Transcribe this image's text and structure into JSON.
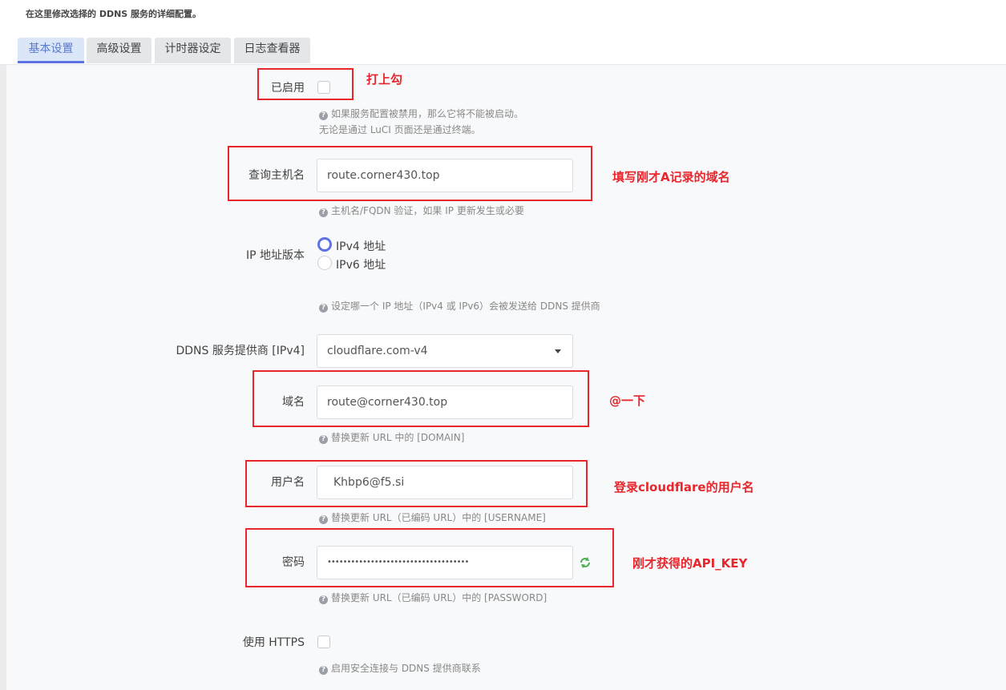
{
  "page": {
    "description": "在这里修改选择的 DDNS 服务的详细配置。"
  },
  "tabs": [
    {
      "label": "基本设置",
      "active": true
    },
    {
      "label": "高级设置",
      "active": false
    },
    {
      "label": "计时器设定",
      "active": false
    },
    {
      "label": "日志查看器",
      "active": false
    }
  ],
  "form": {
    "enabled": {
      "label": "已启用",
      "checked": false,
      "help_line1": "如果服务配置被禁用，那么它将不能被启动。",
      "help_line2": "无论是通过 LuCI 页面还是通过终端。"
    },
    "lookup_host": {
      "label": "查询主机名",
      "value": "route.corner430.top",
      "help": "主机名/FQDN 验证，如果 IP 更新发生或必要"
    },
    "ip_version": {
      "label": "IP 地址版本",
      "options": [
        "IPv4 地址",
        "IPv6 地址"
      ],
      "selected": "IPv4 地址",
      "help": "设定哪一个 IP 地址（IPv4 或 IPv6）会被发送给 DDNS 提供商"
    },
    "provider": {
      "label": "DDNS 服务提供商 [IPv4]",
      "value": "cloudflare.com-v4"
    },
    "domain": {
      "label": "域名",
      "value": "route@corner430.top",
      "help": "替换更新 URL 中的 [DOMAIN]"
    },
    "username": {
      "label": "用户名",
      "value": "Khbp6@f5.si",
      "help": "替换更新 URL（已编码 URL）中的 [USERNAME]"
    },
    "password": {
      "label": "密码",
      "value": "••••••••••••••••••••••••••••••••••••",
      "help": "替换更新 URL（已编码 URL）中的 [PASSWORD]"
    },
    "https": {
      "label": "使用 HTTPS",
      "checked": false,
      "help": "启用安全连接与 DDNS 提供商联系"
    }
  },
  "annotations": {
    "enabled": "打上勾",
    "lookup_host": "填写刚才A记录的域名",
    "domain": "@一下",
    "username": "登录cloudflare的用户名",
    "password": "刚才获得的API_KEY"
  },
  "colors": {
    "annotation_red": "#e8262b",
    "accent": "#5e72e4",
    "reveal_icon": "#4caf50"
  },
  "icons": {
    "help": "question-circle-icon",
    "reveal": "refresh-reveal-icon",
    "select": "caret-down-icon"
  }
}
